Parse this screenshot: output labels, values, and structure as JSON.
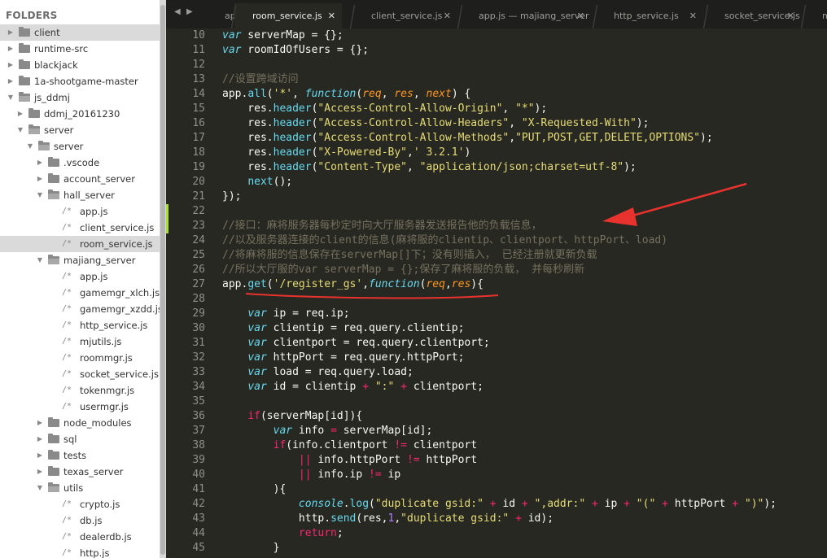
{
  "sidebar": {
    "header": "FOLDERS",
    "items": [
      {
        "label": "client",
        "type": "folder",
        "expanded": false,
        "depth": 0,
        "selected": false,
        "active": true
      },
      {
        "label": "runtime-src",
        "type": "folder",
        "expanded": false,
        "depth": 0
      },
      {
        "label": "blackjack",
        "type": "folder",
        "expanded": false,
        "depth": 0
      },
      {
        "label": "1a-shootgame-master",
        "type": "folder",
        "expanded": false,
        "depth": 0
      },
      {
        "label": "js_ddmj",
        "type": "folder",
        "expanded": true,
        "depth": 0
      },
      {
        "label": "ddmj_20161230",
        "type": "folder",
        "expanded": false,
        "depth": 1
      },
      {
        "label": "server",
        "type": "folder",
        "expanded": true,
        "depth": 1
      },
      {
        "label": "server",
        "type": "folder",
        "expanded": true,
        "depth": 2
      },
      {
        "label": ".vscode",
        "type": "folder",
        "expanded": false,
        "depth": 3
      },
      {
        "label": "account_server",
        "type": "folder",
        "expanded": false,
        "depth": 3
      },
      {
        "label": "hall_server",
        "type": "folder",
        "expanded": true,
        "depth": 3
      },
      {
        "label": "app.js",
        "type": "file",
        "depth": 4
      },
      {
        "label": "client_service.js",
        "type": "file",
        "depth": 4
      },
      {
        "label": "room_service.js",
        "type": "file",
        "depth": 4,
        "selected": true
      },
      {
        "label": "majiang_server",
        "type": "folder",
        "expanded": true,
        "depth": 3
      },
      {
        "label": "app.js",
        "type": "file",
        "depth": 4
      },
      {
        "label": "gamemgr_xlch.js",
        "type": "file",
        "depth": 4
      },
      {
        "label": "gamemgr_xzdd.js",
        "type": "file",
        "depth": 4
      },
      {
        "label": "http_service.js",
        "type": "file",
        "depth": 4
      },
      {
        "label": "mjutils.js",
        "type": "file",
        "depth": 4
      },
      {
        "label": "roommgr.js",
        "type": "file",
        "depth": 4
      },
      {
        "label": "socket_service.js",
        "type": "file",
        "depth": 4
      },
      {
        "label": "tokenmgr.js",
        "type": "file",
        "depth": 4
      },
      {
        "label": "usermgr.js",
        "type": "file",
        "depth": 4
      },
      {
        "label": "node_modules",
        "type": "folder",
        "expanded": false,
        "depth": 3
      },
      {
        "label": "sql",
        "type": "folder",
        "expanded": false,
        "depth": 3
      },
      {
        "label": "tests",
        "type": "folder",
        "expanded": false,
        "depth": 3
      },
      {
        "label": "texas_server",
        "type": "folder",
        "expanded": false,
        "depth": 3
      },
      {
        "label": "utils",
        "type": "folder",
        "expanded": true,
        "depth": 3
      },
      {
        "label": "crypto.js",
        "type": "file",
        "depth": 4
      },
      {
        "label": "db.js",
        "type": "file",
        "depth": 4
      },
      {
        "label": "dealerdb.js",
        "type": "file",
        "depth": 4
      },
      {
        "label": "http.js",
        "type": "file",
        "depth": 4
      }
    ]
  },
  "tabs": [
    {
      "label": "app",
      "active": false,
      "close": ""
    },
    {
      "label": "room_service.js",
      "active": true,
      "close": "✕"
    },
    {
      "label": "client_service.js",
      "active": false,
      "close": "✕"
    },
    {
      "label": "app.js — majiang_server",
      "active": false,
      "close": "✕"
    },
    {
      "label": "http_service.js",
      "active": false,
      "close": "✕"
    },
    {
      "label": "socket_service.js",
      "active": false,
      "close": "✕"
    },
    {
      "label": "mmg",
      "active": false,
      "close": ""
    }
  ],
  "nav": {
    "back": "◀",
    "forward": "▶"
  },
  "editor": {
    "lines": [
      {
        "n": "10",
        "tokens": [
          [
            "kw",
            "var"
          ],
          [
            "",
            " serverMap = {};"
          ]
        ]
      },
      {
        "n": "11",
        "tokens": [
          [
            "kw",
            "var"
          ],
          [
            "",
            " roomIdOfUsers = {};"
          ]
        ]
      },
      {
        "n": "12",
        "tokens": []
      },
      {
        "n": "13",
        "tokens": [
          [
            "cm",
            "//设置跨域访问"
          ]
        ]
      },
      {
        "n": "14",
        "tokens": [
          [
            "",
            "app."
          ],
          [
            "fn",
            "all"
          ],
          [
            "",
            "("
          ],
          [
            "str",
            "'*'"
          ],
          [
            "",
            ", "
          ],
          [
            "kw",
            "function"
          ],
          [
            "",
            "("
          ],
          [
            "prm",
            "req"
          ],
          [
            "",
            ", "
          ],
          [
            "prm",
            "res"
          ],
          [
            "",
            ", "
          ],
          [
            "prm",
            "next"
          ],
          [
            "",
            ") {"
          ]
        ]
      },
      {
        "n": "15",
        "tokens": [
          [
            "",
            "    res."
          ],
          [
            "fn",
            "header"
          ],
          [
            "",
            "("
          ],
          [
            "str",
            "\"Access-Control-Allow-Origin\""
          ],
          [
            "",
            ", "
          ],
          [
            "str",
            "\"*\""
          ],
          [
            "",
            ");"
          ]
        ]
      },
      {
        "n": "16",
        "tokens": [
          [
            "",
            "    res."
          ],
          [
            "fn",
            "header"
          ],
          [
            "",
            "("
          ],
          [
            "str",
            "\"Access-Control-Allow-Headers\""
          ],
          [
            "",
            ", "
          ],
          [
            "str",
            "\"X-Requested-With\""
          ],
          [
            "",
            ");"
          ]
        ]
      },
      {
        "n": "17",
        "tokens": [
          [
            "",
            "    res."
          ],
          [
            "fn",
            "header"
          ],
          [
            "",
            "("
          ],
          [
            "str",
            "\"Access-Control-Allow-Methods\""
          ],
          [
            "",
            ","
          ],
          [
            "str",
            "\"PUT,POST,GET,DELETE,OPTIONS\""
          ],
          [
            "",
            ");"
          ]
        ]
      },
      {
        "n": "18",
        "tokens": [
          [
            "",
            "    res."
          ],
          [
            "fn",
            "header"
          ],
          [
            "",
            "("
          ],
          [
            "str",
            "\"X-Powered-By\""
          ],
          [
            "",
            ","
          ],
          [
            "str",
            "' 3.2.1'"
          ],
          [
            "",
            ")"
          ]
        ]
      },
      {
        "n": "19",
        "tokens": [
          [
            "",
            "    res."
          ],
          [
            "fn",
            "header"
          ],
          [
            "",
            "("
          ],
          [
            "str",
            "\"Content-Type\""
          ],
          [
            "",
            ", "
          ],
          [
            "str",
            "\"application/json;charset=utf-8\""
          ],
          [
            "",
            ");"
          ]
        ]
      },
      {
        "n": "20",
        "tokens": [
          [
            "",
            "    "
          ],
          [
            "fn",
            "next"
          ],
          [
            "",
            "();"
          ]
        ]
      },
      {
        "n": "21",
        "tokens": [
          [
            "",
            "});"
          ]
        ]
      },
      {
        "n": "22",
        "tokens": [],
        "mod": true
      },
      {
        "n": "23",
        "tokens": [
          [
            "cm",
            "//接口：麻将服务器每秒定时向大厅服务器发送报告他的负载信息，"
          ]
        ],
        "mod": true
      },
      {
        "n": "24",
        "tokens": [
          [
            "cm",
            "//以及服务器连接的client的信息(麻将服的clientip、clientport、httpPort、load)"
          ]
        ]
      },
      {
        "n": "25",
        "tokens": [
          [
            "cm",
            "//将麻将服的信息保存在serverMap[]下；没有则插入， 已经注册就更新负载"
          ]
        ]
      },
      {
        "n": "26",
        "tokens": [
          [
            "cm",
            "//所以大厅服的var serverMap = {};保存了麻将服的负载， 并每秒刷新"
          ]
        ]
      },
      {
        "n": "27",
        "tokens": [
          [
            "",
            "app."
          ],
          [
            "fn",
            "get"
          ],
          [
            "",
            "("
          ],
          [
            "str",
            "'/register_gs'"
          ],
          [
            "",
            ","
          ],
          [
            "kw",
            "function"
          ],
          [
            "",
            "("
          ],
          [
            "prm",
            "req"
          ],
          [
            "",
            ","
          ],
          [
            "prm",
            "res"
          ],
          [
            "",
            "){"
          ]
        ]
      },
      {
        "n": "28",
        "tokens": []
      },
      {
        "n": "29",
        "tokens": [
          [
            "",
            "    "
          ],
          [
            "kw",
            "var"
          ],
          [
            "",
            " ip = req.ip;"
          ]
        ]
      },
      {
        "n": "30",
        "tokens": [
          [
            "",
            "    "
          ],
          [
            "kw",
            "var"
          ],
          [
            "",
            " clientip = req.query.clientip;"
          ]
        ]
      },
      {
        "n": "31",
        "tokens": [
          [
            "",
            "    "
          ],
          [
            "kw",
            "var"
          ],
          [
            "",
            " clientport = req.query.clientport;"
          ]
        ]
      },
      {
        "n": "32",
        "tokens": [
          [
            "",
            "    "
          ],
          [
            "kw",
            "var"
          ],
          [
            "",
            " httpPort = req.query.httpPort;"
          ]
        ]
      },
      {
        "n": "33",
        "tokens": [
          [
            "",
            "    "
          ],
          [
            "kw",
            "var"
          ],
          [
            "",
            " load = req.query.load;"
          ]
        ]
      },
      {
        "n": "34",
        "tokens": [
          [
            "",
            "    "
          ],
          [
            "kw",
            "var"
          ],
          [
            "",
            " id = clientip "
          ],
          [
            "op",
            "+"
          ],
          [
            "",
            " "
          ],
          [
            "str",
            "\":\""
          ],
          [
            "",
            " "
          ],
          [
            "op",
            "+"
          ],
          [
            "",
            " clientport;"
          ]
        ]
      },
      {
        "n": "35",
        "tokens": []
      },
      {
        "n": "36",
        "tokens": [
          [
            "",
            "    "
          ],
          [
            "op",
            "if"
          ],
          [
            "",
            "(serverMap[id]){"
          ]
        ]
      },
      {
        "n": "37",
        "tokens": [
          [
            "",
            "        "
          ],
          [
            "kw",
            "var"
          ],
          [
            "",
            " info "
          ],
          [
            "op",
            "="
          ],
          [
            "",
            " serverMap[id];"
          ]
        ]
      },
      {
        "n": "38",
        "tokens": [
          [
            "",
            "        "
          ],
          [
            "op",
            "if"
          ],
          [
            "",
            "(info.clientport "
          ],
          [
            "op",
            "!="
          ],
          [
            "",
            " clientport"
          ]
        ]
      },
      {
        "n": "39",
        "tokens": [
          [
            "",
            "            "
          ],
          [
            "op",
            "||"
          ],
          [
            "",
            " info.httpPort "
          ],
          [
            "op",
            "!="
          ],
          [
            "",
            " httpPort"
          ]
        ]
      },
      {
        "n": "40",
        "tokens": [
          [
            "",
            "            "
          ],
          [
            "op",
            "||"
          ],
          [
            "",
            " info.ip "
          ],
          [
            "op",
            "!="
          ],
          [
            "",
            " ip"
          ]
        ]
      },
      {
        "n": "41",
        "tokens": [
          [
            "",
            "        ){"
          ]
        ]
      },
      {
        "n": "42",
        "tokens": [
          [
            "",
            "            "
          ],
          [
            "kw",
            "console"
          ],
          [
            "",
            "."
          ],
          [
            "fn",
            "log"
          ],
          [
            "",
            "("
          ],
          [
            "str",
            "\"duplicate gsid:\""
          ],
          [
            "",
            " "
          ],
          [
            "op",
            "+"
          ],
          [
            "",
            " id "
          ],
          [
            "op",
            "+"
          ],
          [
            "",
            " "
          ],
          [
            "str",
            "\",addr:\""
          ],
          [
            "",
            " "
          ],
          [
            "op",
            "+"
          ],
          [
            "",
            " ip "
          ],
          [
            "op",
            "+"
          ],
          [
            "",
            " "
          ],
          [
            "str",
            "\"(\""
          ],
          [
            "",
            " "
          ],
          [
            "op",
            "+"
          ],
          [
            "",
            " httpPort "
          ],
          [
            "op",
            "+"
          ],
          [
            "",
            " "
          ],
          [
            "str",
            "\")\""
          ],
          [
            "",
            ");"
          ]
        ]
      },
      {
        "n": "43",
        "tokens": [
          [
            "",
            "            http."
          ],
          [
            "fn",
            "send"
          ],
          [
            "",
            "(res,"
          ],
          [
            "num",
            "1"
          ],
          [
            "",
            ","
          ],
          [
            "str",
            "\"duplicate gsid:\""
          ],
          [
            "",
            " "
          ],
          [
            "op",
            "+"
          ],
          [
            "",
            " id);"
          ]
        ]
      },
      {
        "n": "44",
        "tokens": [
          [
            "",
            "            "
          ],
          [
            "op",
            "return"
          ],
          [
            "",
            ";"
          ]
        ]
      },
      {
        "n": "45",
        "tokens": [
          [
            "",
            "        }"
          ]
        ]
      }
    ]
  },
  "colors": {
    "annotation": "#e8322e",
    "background": "#272822"
  }
}
